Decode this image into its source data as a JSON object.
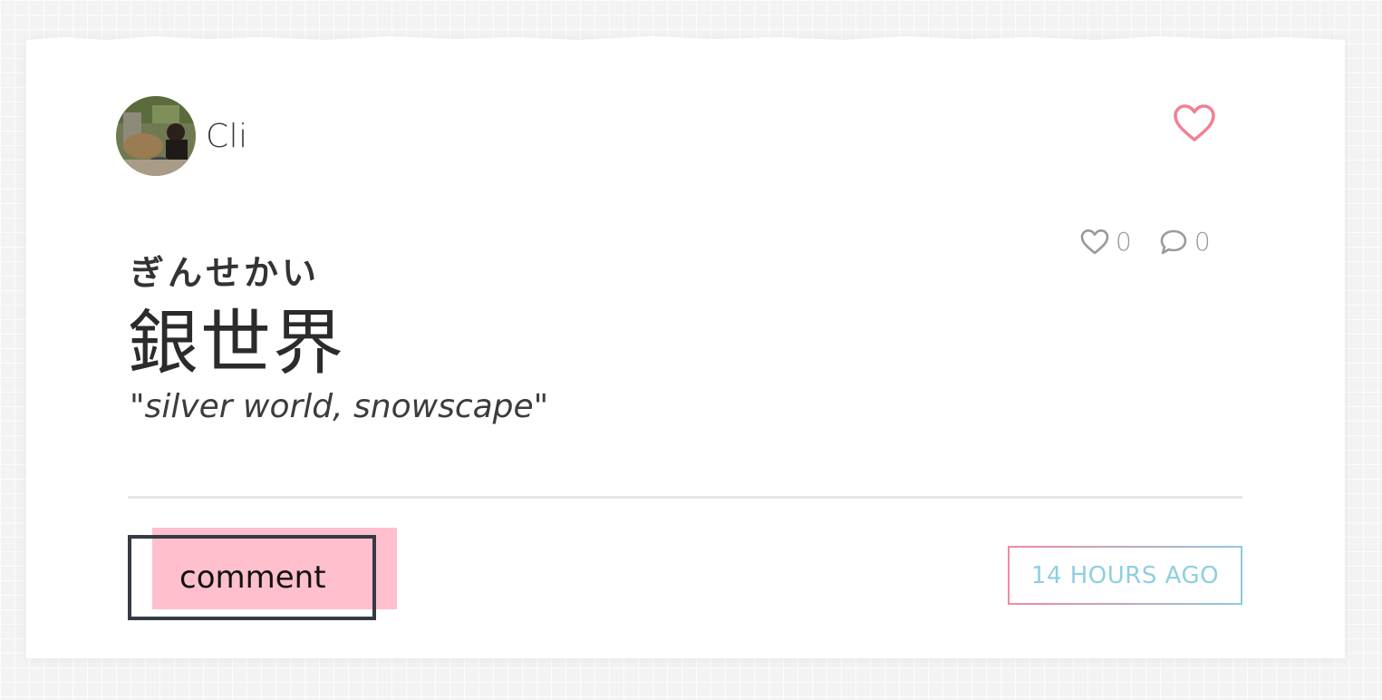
{
  "card": {
    "author": {
      "name": "Cli",
      "avatar_icon": "user-photo-avatar"
    },
    "favorite_icon": "heart-outline-icon",
    "stats": {
      "likes": "0",
      "comments": "0",
      "like_icon": "heart-outline-icon",
      "comment_icon": "speech-bubble-icon"
    },
    "reading": "ぎんせかい",
    "word": "銀世界",
    "meaning": "\"silver world, snowscape\"",
    "comment_label": "comment",
    "timestamp": "14 HOURS AGO"
  },
  "colors": {
    "accent_pink": "#f27f93",
    "accent_blue": "#8ecfe0",
    "comment_bg": "#ffbfcc",
    "comment_border": "#363a45",
    "muted": "#9a9a9a"
  }
}
